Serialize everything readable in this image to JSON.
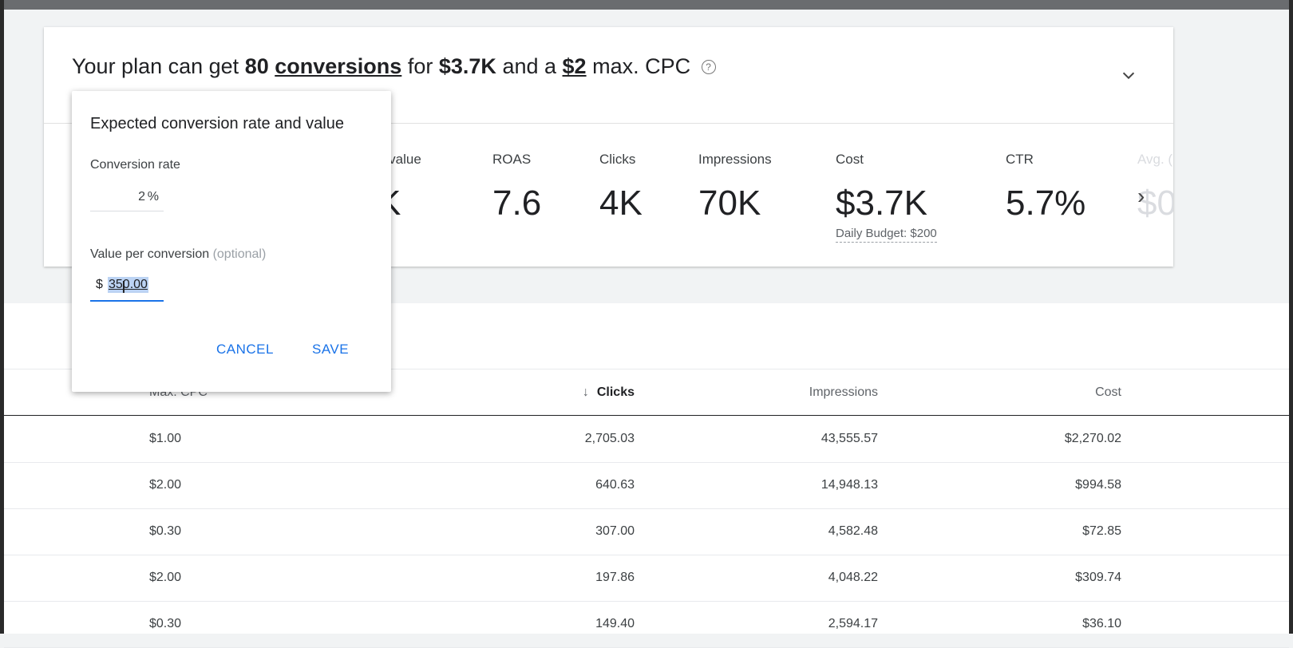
{
  "summary": {
    "headline": {
      "prefix": "Your plan can get",
      "conversions_num": "80",
      "conversions_word": "conversions",
      "for_word": "for",
      "cost": "$3.7K",
      "and_a": "and a",
      "cpc": "$2",
      "suffix": "max. CPC"
    },
    "help_icon_glyph": "?",
    "expand_icon": "chevron-down-icon",
    "metrics": [
      {
        "label": "n value",
        "value": "K"
      },
      {
        "label": "ROAS",
        "value": "7.6"
      },
      {
        "label": "Clicks",
        "value": "4K"
      },
      {
        "label": "Impressions",
        "value": "70K"
      },
      {
        "label": "Cost",
        "value": "$3.7K",
        "sub": "Daily Budget: $200"
      },
      {
        "label": "CTR",
        "value": "5.7%"
      },
      {
        "label": "Avg. (",
        "value": "$0"
      }
    ],
    "next_icon": "chevron-right-icon",
    "next_glyph": "›"
  },
  "table": {
    "columns": [
      "Max. CPC",
      "Clicks",
      "Impressions",
      "Cost"
    ],
    "sort_glyph": "↓",
    "sorted_column": "Clicks",
    "rows": [
      [
        "$1.00",
        "2,705.03",
        "43,555.57",
        "$2,270.02"
      ],
      [
        "$2.00",
        "640.63",
        "14,948.13",
        "$994.58"
      ],
      [
        "$0.30",
        "307.00",
        "4,582.48",
        "$72.85"
      ],
      [
        "$2.00",
        "197.86",
        "4,048.22",
        "$309.74"
      ],
      [
        "$0.30",
        "149.40",
        "2,594.17",
        "$36.10"
      ]
    ]
  },
  "dialog": {
    "title": "Expected conversion rate and value",
    "conversion_rate_label": "Conversion rate",
    "conversion_rate_value": "2",
    "conversion_rate_unit": "%",
    "value_label": "Value per conversion",
    "value_optional": "(optional)",
    "currency": "$",
    "value": "350.00",
    "cursor_glyph": "I",
    "cancel_label": "CANCEL",
    "save_label": "SAVE"
  },
  "colors": {
    "accent": "#1a73e8",
    "selection": "#bcd3f3"
  }
}
